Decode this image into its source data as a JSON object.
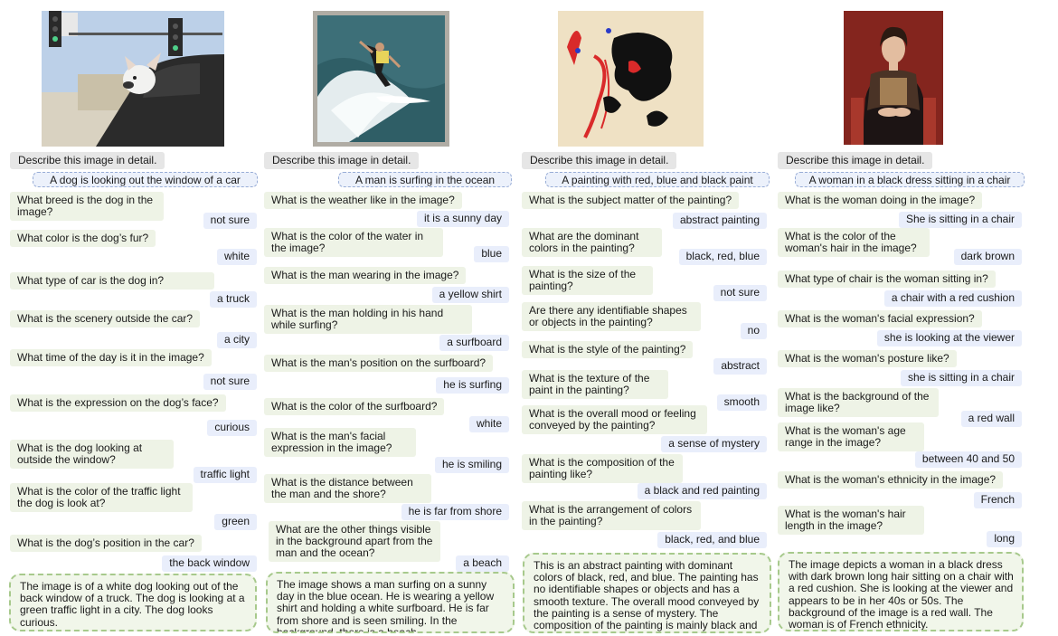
{
  "columns": [
    {
      "image_label": "dog-photo",
      "instruction": "Describe this image in detail.",
      "caption": "A dog is looking out the window of a car",
      "qa": [
        {
          "q": "What breed is the dog in the image?",
          "a": "not sure"
        },
        {
          "q": "What color is the dog’s fur?",
          "a": "white"
        },
        {
          "q": "What type of car is the dog in?",
          "a": "a truck"
        },
        {
          "q": "What is the scenery outside the car?",
          "a": "a city"
        },
        {
          "q": "What time of the day is it in the image?",
          "a": "not sure"
        },
        {
          "q": "What is the expression on the dog’s face?",
          "a": "curious"
        },
        {
          "q": "What is the dog looking at outside the window?",
          "a": "traffic light"
        },
        {
          "q": "What is the color of the traffic light the dog is look at?",
          "a": "green"
        },
        {
          "q": "What is the dog’s position in the car?",
          "a": "the back window"
        }
      ],
      "summary": "The image is of a white dog looking out of the back window of a truck. The dog is looking at a green traffic light in a city. The dog looks curious."
    },
    {
      "image_label": "surfer-photo",
      "instruction": "Describe this image in detail.",
      "caption": "A man is surfing in the ocean",
      "qa": [
        {
          "q": "What is the weather like in the image?",
          "a": "it is a sunny day"
        },
        {
          "q": "What is the color of the water in the image?",
          "a": "blue"
        },
        {
          "q": "What is the man wearing in the image?",
          "a": "a yellow shirt"
        },
        {
          "q": "What is the man holding in his hand while surfing?",
          "a": "a surfboard"
        },
        {
          "q": "What is the man's position on the surfboard?",
          "a": "he is surfing"
        },
        {
          "q": "What is the color of the surfboard?",
          "a": "white"
        },
        {
          "q": "What is the man's facial expression in the image?",
          "a": "he is smiling"
        },
        {
          "q": "What is the distance between the man and the shore?",
          "a": "he is far from shore"
        },
        {
          "q": "What are the other things visible in the background apart from the man and the ocean?",
          "a": "a beach"
        }
      ],
      "summary": "The image shows a man surfing on a sunny day in the blue ocean. He is wearing a yellow shirt and holding a white surfboard. He is far from shore and is seen smiling. In the background, there is a beach."
    },
    {
      "image_label": "abstract-painting",
      "instruction": "Describe this image in detail.",
      "caption": "A painting with red, blue and black paint",
      "qa": [
        {
          "q": "What is the subject matter of the painting?",
          "a": "abstract painting"
        },
        {
          "q": "What are the dominant colors in the painting?",
          "a": "black, red, blue"
        },
        {
          "q": "What is the size of the painting?",
          "a": "not sure"
        },
        {
          "q": "Are there any identifiable shapes or objects in the painting?",
          "a": "no"
        },
        {
          "q": "What is the style of the painting?",
          "a": "abstract"
        },
        {
          "q": "What is the texture of the paint in the painting?",
          "a": "smooth"
        },
        {
          "q": "What is the overall mood or feeling conveyed by the painting?",
          "a": "a sense of mystery"
        },
        {
          "q": "What is the composition of the painting like?",
          "a": "a black and red painting"
        },
        {
          "q": "What is the arrangement of colors in the painting?",
          "a": "black, red, and blue"
        }
      ],
      "summary": "This is an abstract painting with dominant colors of black, red, and blue. The painting has no identifiable shapes or objects and has a smooth texture. The overall mood conveyed by the painting is a sense of mystery. The composition of the painting is mainly black and red."
    },
    {
      "image_label": "woman-portrait",
      "instruction": "Describe this image in detail.",
      "caption": "A woman in a black dress sitting in a chair",
      "qa": [
        {
          "q": "What is the woman doing in the image?",
          "a": "She is sitting in a chair"
        },
        {
          "q": "What is the color of the woman's hair in the image?",
          "a": "dark brown"
        },
        {
          "q": "What type of chair is the woman sitting in?",
          "a": "a chair with a red cushion"
        },
        {
          "q": "What is the woman's facial expression?",
          "a": "she is looking at the viewer"
        },
        {
          "q": "What is the woman's posture like?",
          "a": "she is sitting in a chair"
        },
        {
          "q": "What is the background of the image like?",
          "a": "a red wall"
        },
        {
          "q": "What is the woman's age range in the image?",
          "a": "between 40 and 50"
        },
        {
          "q": "What is the woman's ethnicity in the image?",
          "a": "French"
        },
        {
          "q": "What is the woman's hair length in the image?",
          "a": "long"
        }
      ],
      "summary": "The image depicts a woman in a black dress with dark brown long hair sitting on a chair with a red cushion. She is looking at the viewer and appears to be in her 40s or 50s. The background of the image is a red wall. The woman is of French ethnicity."
    }
  ]
}
